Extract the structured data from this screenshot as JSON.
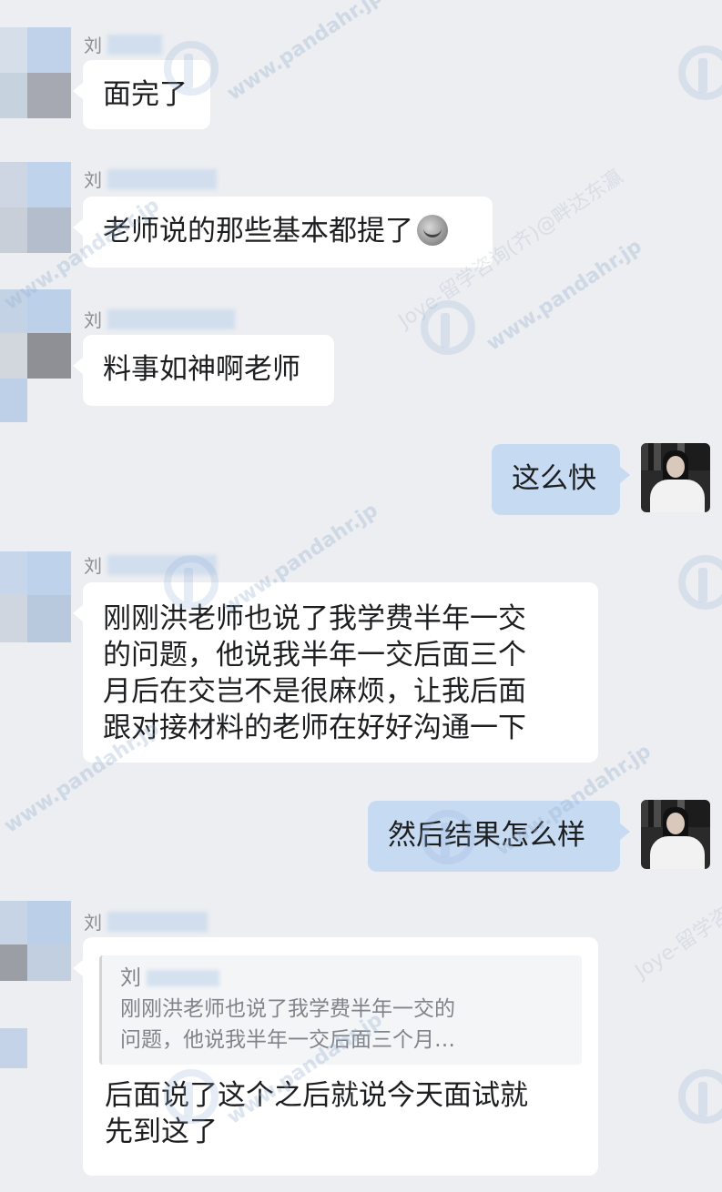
{
  "contact": {
    "name_prefix": "刘"
  },
  "messages": [
    {
      "sender": "contact",
      "text": "面完了"
    },
    {
      "sender": "contact",
      "text": "老师说的那些基本都提了",
      "emoji": "grimace-emoji"
    },
    {
      "sender": "contact",
      "text": "料事如神啊老师"
    },
    {
      "sender": "self",
      "text": "这么快"
    },
    {
      "sender": "contact",
      "lines": [
        "刚刚洪老师也说了我学费半年一交",
        "的问题，他说我半年一交后面三个",
        "月后在交岂不是很麻烦，让我后面",
        "跟对接材料的老师在好好沟通一下"
      ]
    },
    {
      "sender": "self",
      "text": "然后结果怎么样"
    },
    {
      "sender": "contact",
      "quote": {
        "name": "刘",
        "lines": [
          "刚刚洪老师也说了我学费半年一交的",
          "问题，他说我半年一交后面三个月…"
        ]
      },
      "lines": [
        "后面说了这个之后就说今天面试就",
        "先到这了"
      ]
    }
  ],
  "watermark": {
    "site": "www.pandahr.jp",
    "brand": "Joye-留学咨询(齐)@畔达东瀛"
  },
  "colors": {
    "background": "#eceef1",
    "incoming_bubble": "#ffffff",
    "outgoing_bubble": "#c6daf2",
    "name_label": "#8b8e94"
  }
}
